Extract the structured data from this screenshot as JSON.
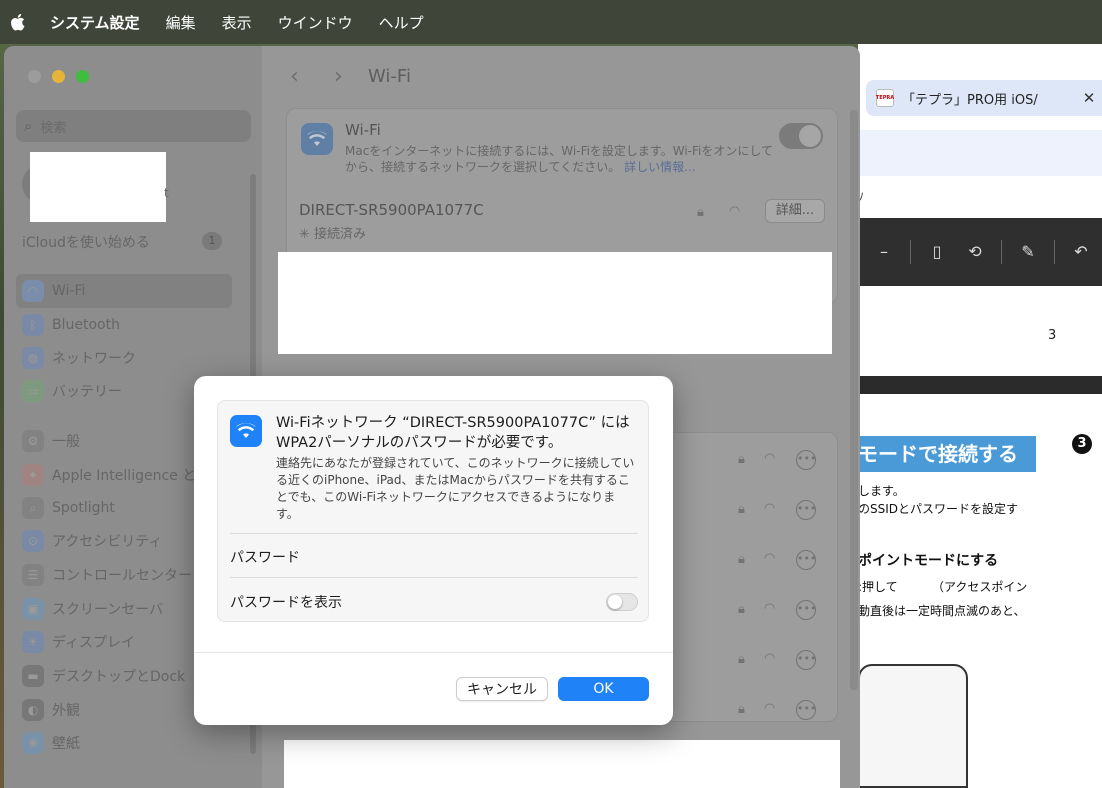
{
  "menubar": {
    "items": [
      "システム設定",
      "編集",
      "表示",
      "ウインドウ",
      "ヘルプ"
    ]
  },
  "browser": {
    "tab_title": "「テプラ」PRO用 iOS/",
    "tab_close": "✕",
    "page_number": "3",
    "banner": "モードで接続する",
    "step_badge": "❸",
    "lines": [
      "します。",
      "のSSIDとパスワードを設定す",
      "ポイントモードにする",
      ":押して",
      "（アクセスポイン",
      "動直後は一定時間点滅のあと、"
    ]
  },
  "settings": {
    "search_placeholder": "検索",
    "account_tail": "t",
    "icloud": "iCloudを使い始める",
    "icloud_count": "1",
    "sidebar": [
      {
        "label": "Wi-Fi",
        "icon": "wifi-icon",
        "active": true
      },
      {
        "label": "Bluetooth",
        "icon": "bluetooth-icon"
      },
      {
        "label": "ネットワーク",
        "icon": "network-icon"
      },
      {
        "label": "バッテリー",
        "icon": "battery-icon"
      },
      {
        "label": "一般",
        "icon": "gear-icon"
      },
      {
        "label": "Apple Intelligence と",
        "icon": "apple-intelligence-icon"
      },
      {
        "label": "Spotlight",
        "icon": "spotlight-icon"
      },
      {
        "label": "アクセシビリティ",
        "icon": "accessibility-icon"
      },
      {
        "label": "コントロールセンター",
        "icon": "control-center-icon"
      },
      {
        "label": "スクリーンセーバ",
        "icon": "screensaver-icon"
      },
      {
        "label": "ディスプレイ",
        "icon": "display-icon"
      },
      {
        "label": "デスクトップとDock",
        "icon": "desktop-dock-icon"
      },
      {
        "label": "外観",
        "icon": "appearance-icon"
      },
      {
        "label": "壁紙",
        "icon": "wallpaper-icon"
      }
    ],
    "main": {
      "title": "Wi-Fi",
      "wifi_title": "Wi-Fi",
      "wifi_desc": "Macをインターネットに接続するには、Wi-Fiを設定します。Wi-Fiをオンにしてから、接続するネットワークを選択してください。",
      "wifi_link": "詳しい情報...",
      "network_name": "DIRECT-SR5900PA1077C",
      "network_status": "接続済み",
      "detail_button": "詳細..."
    }
  },
  "dialog": {
    "heading": "Wi-Fiネットワーク “DIRECT-SR5900PA1077C” にはWPA2パーソナルのパスワードが必要です。",
    "body": "連絡先にあなたが登録されていて、このネットワークに接続している近くのiPhone、iPad、またはMacからパスワードを共有することでも、このWi-Fiネットワークにアクセスできるようになります。",
    "password_label": "パスワード",
    "password_value": "",
    "show_password_label": "パスワードを表示",
    "show_password_on": false,
    "cancel_label": "キャンセル",
    "ok_label": "OK",
    "accent_color": "#1f82f7"
  }
}
